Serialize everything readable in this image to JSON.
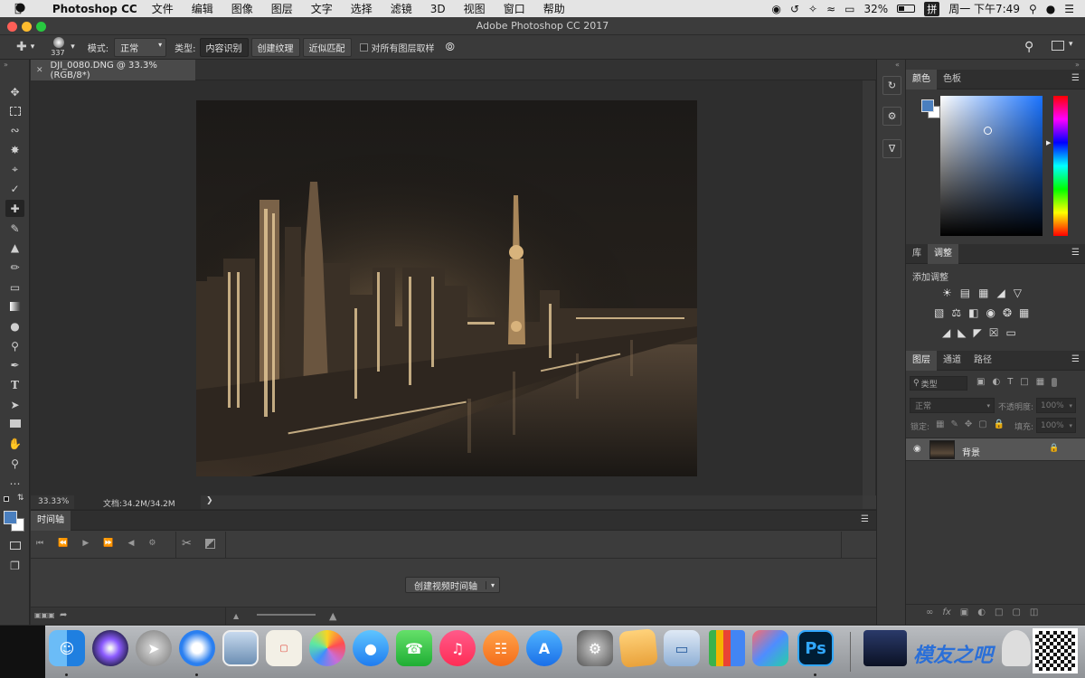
{
  "menubar": {
    "app_name": "Photoshop CC",
    "items": [
      "文件",
      "编辑",
      "图像",
      "图层",
      "文字",
      "选择",
      "滤镜",
      "3D",
      "视图",
      "窗口",
      "帮助"
    ],
    "battery": "32%",
    "clock": "周一 下午7:49",
    "input_method": "拼"
  },
  "window": {
    "title": "Adobe Photoshop CC 2017"
  },
  "options": {
    "brush_size": "337",
    "mode_label": "模式:",
    "mode_value": "正常",
    "type_label": "类型:",
    "type_buttons": [
      "内容识别",
      "创建纹理",
      "近似匹配"
    ],
    "sample_all": "对所有图层取样"
  },
  "document": {
    "tab_title": "DJI_0080.DNG @ 33.3%(RGB/8*)",
    "zoom": "33.33%",
    "doc_size": "文档:34.2M/34.2M"
  },
  "timeline": {
    "tab": "时间轴",
    "create_button": "创建视频时间轴"
  },
  "color_panel": {
    "tabs": [
      "颜色",
      "色板"
    ],
    "foreground": "#4a7fbf",
    "background": "#ffffff"
  },
  "adjust_panel": {
    "tabs": [
      "库",
      "调整"
    ],
    "add_label": "添加调整"
  },
  "layers_panel": {
    "tabs": [
      "图层",
      "通道",
      "路径"
    ],
    "filter_kind": "类型",
    "blend_mode": "正常",
    "opacity_label": "不透明度:",
    "opacity_value": "100%",
    "lock_label": "锁定:",
    "fill_label": "填充:",
    "fill_value": "100%",
    "layers": [
      {
        "name": "背景"
      }
    ]
  },
  "dock": {
    "watermark": "模友之吧"
  }
}
